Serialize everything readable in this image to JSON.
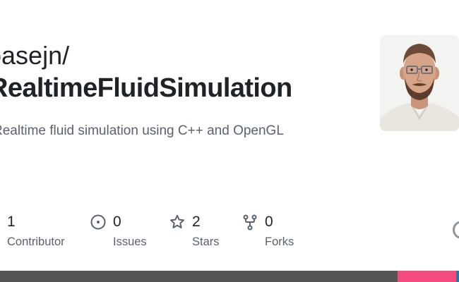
{
  "repo": {
    "owner": "basejn/",
    "name": "RealtimeFluidSimulation",
    "description": "Realtime fluid simulation using C++ and OpenGL"
  },
  "avatar": {
    "icon": "user-avatar-photo"
  },
  "stats": [
    {
      "count": "1",
      "label": "Contributor",
      "icon": "people-icon"
    },
    {
      "count": "0",
      "label": "Issues",
      "icon": "issue-opened-icon"
    },
    {
      "count": "2",
      "label": "Stars",
      "icon": "star-icon"
    },
    {
      "count": "0",
      "label": "Forks",
      "icon": "repo-forked-icon"
    }
  ],
  "colors": {
    "title": "#1f2328",
    "muted": "#59636e",
    "languages": [
      "#555555",
      "#f34b7d",
      "#3572a5"
    ]
  }
}
